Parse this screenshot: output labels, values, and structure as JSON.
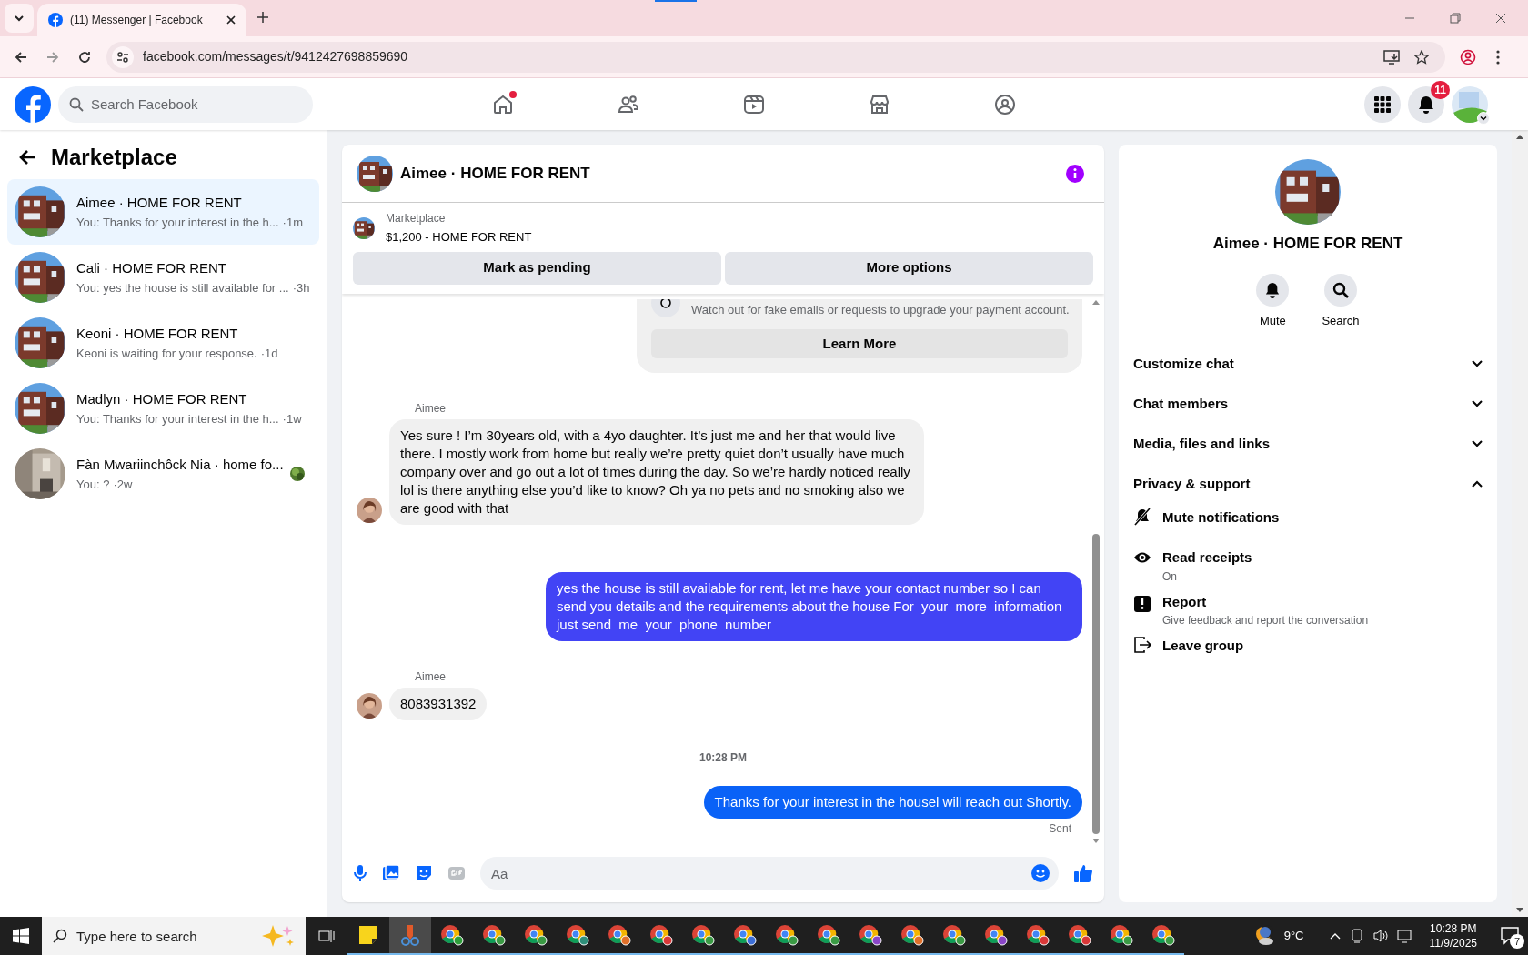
{
  "browser": {
    "tab_title": "(11) Messenger | Facebook",
    "url": "facebook.com/messages/t/9412427698859690"
  },
  "header": {
    "search_placeholder": "Search Facebook",
    "nav": [
      {
        "kind": "home",
        "dot": true
      },
      {
        "kind": "friends",
        "dot": false
      },
      {
        "kind": "video",
        "dot": false
      },
      {
        "kind": "marketplace",
        "dot": false
      },
      {
        "kind": "gaming",
        "dot": false
      }
    ],
    "notification_count": "11"
  },
  "sidebar": {
    "title": "Marketplace",
    "chats": [
      {
        "name": "Aimee · HOME FOR RENT",
        "preview": "You: Thanks for your interest in the h...",
        "time": "·1m",
        "selected": true,
        "kind": "house",
        "seen": false
      },
      {
        "name": "Cali · HOME FOR RENT",
        "preview": "You: yes the house is still available for ...",
        "time": "·3h",
        "selected": false,
        "kind": "house",
        "seen": false
      },
      {
        "name": "Keoni · HOME FOR RENT",
        "preview": "Keoni is waiting for your response.",
        "time": "·1d",
        "selected": false,
        "kind": "house",
        "seen": false
      },
      {
        "name": "Madlyn · HOME FOR RENT",
        "preview": "You: Thanks for your interest in the h...",
        "time": "·1w",
        "selected": false,
        "kind": "house",
        "seen": false
      },
      {
        "name": "Fàn Mwariinchôck Nia · home fo...",
        "preview": "You: ?",
        "time": "·2w",
        "selected": false,
        "kind": "room",
        "seen": true
      }
    ]
  },
  "chat": {
    "title": "Aimee · HOME FOR RENT",
    "listing": {
      "label": "Marketplace",
      "title": "$1,200 - HOME FOR RENT"
    },
    "actions": [
      "Mark as pending",
      "More options"
    ],
    "messages": [
      {
        "kind": "notice",
        "text": "Watch out for fake emails or requests to upgrade your payment account.",
        "button": "Learn More"
      },
      {
        "kind": "incoming",
        "sender": "Aimee",
        "text": "Yes sure ! I’m 30years old, with a 4yo daughter. It’s just me and her that would live there. I mostly work from home but really we’re pretty quiet don’t usually have much company over and go out a lot of times during the day. So we’re hardly noticed really lol is there anything else you’d like to know? Oh ya no pets and no smoking also we are good with that"
      },
      {
        "kind": "outgoing",
        "text": "yes the house is still available for rent, let me have your contact number so I can send you details and the requirements about the house For  your  more  information  just send  me  your  phone  number",
        "color": "#4244f5"
      },
      {
        "kind": "incoming",
        "sender": "Aimee",
        "text": "8083931392"
      },
      {
        "kind": "time",
        "text": "10:28 PM"
      },
      {
        "kind": "outgoing",
        "text": "Thanks for your interest in the housel will reach out Shortly.",
        "color": "#0a62f7",
        "status": "Sent"
      }
    ],
    "composer": {
      "placeholder": "Aa"
    }
  },
  "details": {
    "title": "Aimee · HOME FOR RENT",
    "actions": [
      {
        "kind": "mute",
        "label": "Mute"
      },
      {
        "kind": "search",
        "label": "Search"
      }
    ],
    "sections": [
      {
        "label": "Customize chat",
        "expanded": false
      },
      {
        "label": "Chat members",
        "expanded": false
      },
      {
        "label": "Media, files and links",
        "expanded": false
      },
      {
        "label": "Privacy & support",
        "expanded": true,
        "items": [
          {
            "kind": "mute",
            "label": "Mute notifications"
          },
          {
            "kind": "eye",
            "label": "Read receipts",
            "sub": "On"
          },
          {
            "kind": "report",
            "label": "Report",
            "sub": "Give feedback and report the conversation"
          },
          {
            "kind": "leave",
            "label": "Leave group"
          }
        ]
      }
    ]
  },
  "taskbar": {
    "search_placeholder": "Type here to search",
    "weather": "9°C",
    "time": "10:28 PM",
    "date": "11/9/2025",
    "notification_count": "7",
    "apps": [
      {
        "kind": "taskview"
      },
      {
        "kind": "notes"
      },
      {
        "kind": "tool"
      },
      {
        "kind": "browser",
        "color": "#2e9d3a"
      },
      {
        "kind": "browser",
        "color": "#3a9a44"
      },
      {
        "kind": "browser",
        "color": "#3a9a44"
      },
      {
        "kind": "browser",
        "color": "#2f8f7a"
      },
      {
        "kind": "browser",
        "color": "#e0702a"
      },
      {
        "kind": "browser",
        "color": "#d93838"
      },
      {
        "kind": "browser",
        "color": "#3a9a44"
      },
      {
        "kind": "browser",
        "color": "#3d6fd8"
      },
      {
        "kind": "browser",
        "color": "#3a9a44"
      },
      {
        "kind": "browser",
        "color": "#3a9a44"
      },
      {
        "kind": "browser",
        "color": "#8a46c8"
      },
      {
        "kind": "browser",
        "color": "#e0702a"
      },
      {
        "kind": "browser",
        "color": "#3a9a44"
      },
      {
        "kind": "browser",
        "color": "#8a46c8"
      },
      {
        "kind": "browser",
        "color": "#d93838"
      },
      {
        "kind": "browser",
        "color": "#d93838"
      },
      {
        "kind": "browser",
        "color": "#3a9a44"
      },
      {
        "kind": "browser",
        "color": "#3a9a44"
      }
    ]
  }
}
